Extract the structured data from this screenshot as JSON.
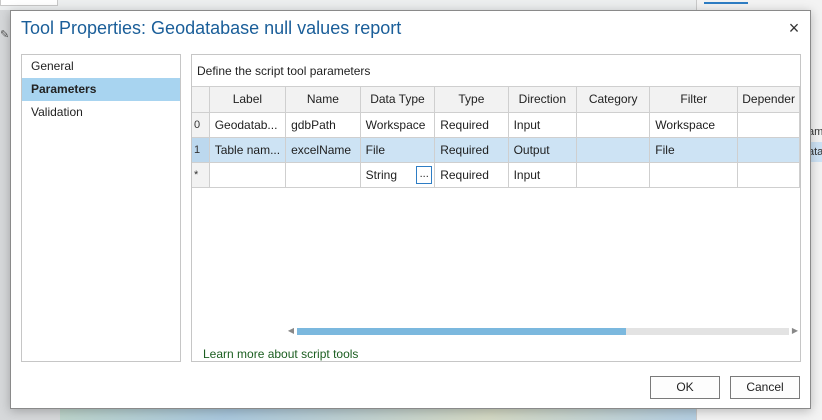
{
  "dialog": {
    "title": "Tool Properties: Geodatabase null values report",
    "close_symbol": "×"
  },
  "nav": {
    "items": [
      {
        "label": "General",
        "active": false
      },
      {
        "label": "Parameters",
        "active": true
      },
      {
        "label": "Validation",
        "active": false
      }
    ]
  },
  "panel": {
    "heading": "Define the script tool parameters",
    "columns": [
      "",
      "Label",
      "Name",
      "Data Type",
      "Type",
      "Direction",
      "Category",
      "Filter",
      "Depender"
    ],
    "rows": [
      {
        "index": "0",
        "label": "Geodatab...",
        "name": "gdbPath",
        "data_type": "Workspace",
        "type": "Required",
        "direction": "Input",
        "category": "",
        "filter": "Workspace",
        "dependency": "",
        "selected": false
      },
      {
        "index": "1",
        "label": "Table nam...",
        "name": "excelName",
        "data_type": "File",
        "type": "Required",
        "direction": "Output",
        "category": "",
        "filter": "File",
        "dependency": "",
        "selected": true
      },
      {
        "index": "*",
        "label": "",
        "name": "",
        "data_type": "String",
        "type": "Required",
        "direction": "Input",
        "category": "",
        "filter": "",
        "dependency": "",
        "selected": false
      }
    ],
    "ellipsis_label": "...",
    "learn_more": "Learn more about script tools",
    "scroll_position_fraction": 0.67
  },
  "buttons": {
    "ok": "OK",
    "cancel": "Cancel"
  },
  "background": {
    "right_panel_snippet": [
      "am",
      "ata"
    ]
  },
  "colors": {
    "title": "#1a5e99",
    "nav_active": "#a8d4f0",
    "row_selected": "#cde3f4",
    "link": "#1b5e20",
    "scroll_thumb": "#7bb8de"
  }
}
